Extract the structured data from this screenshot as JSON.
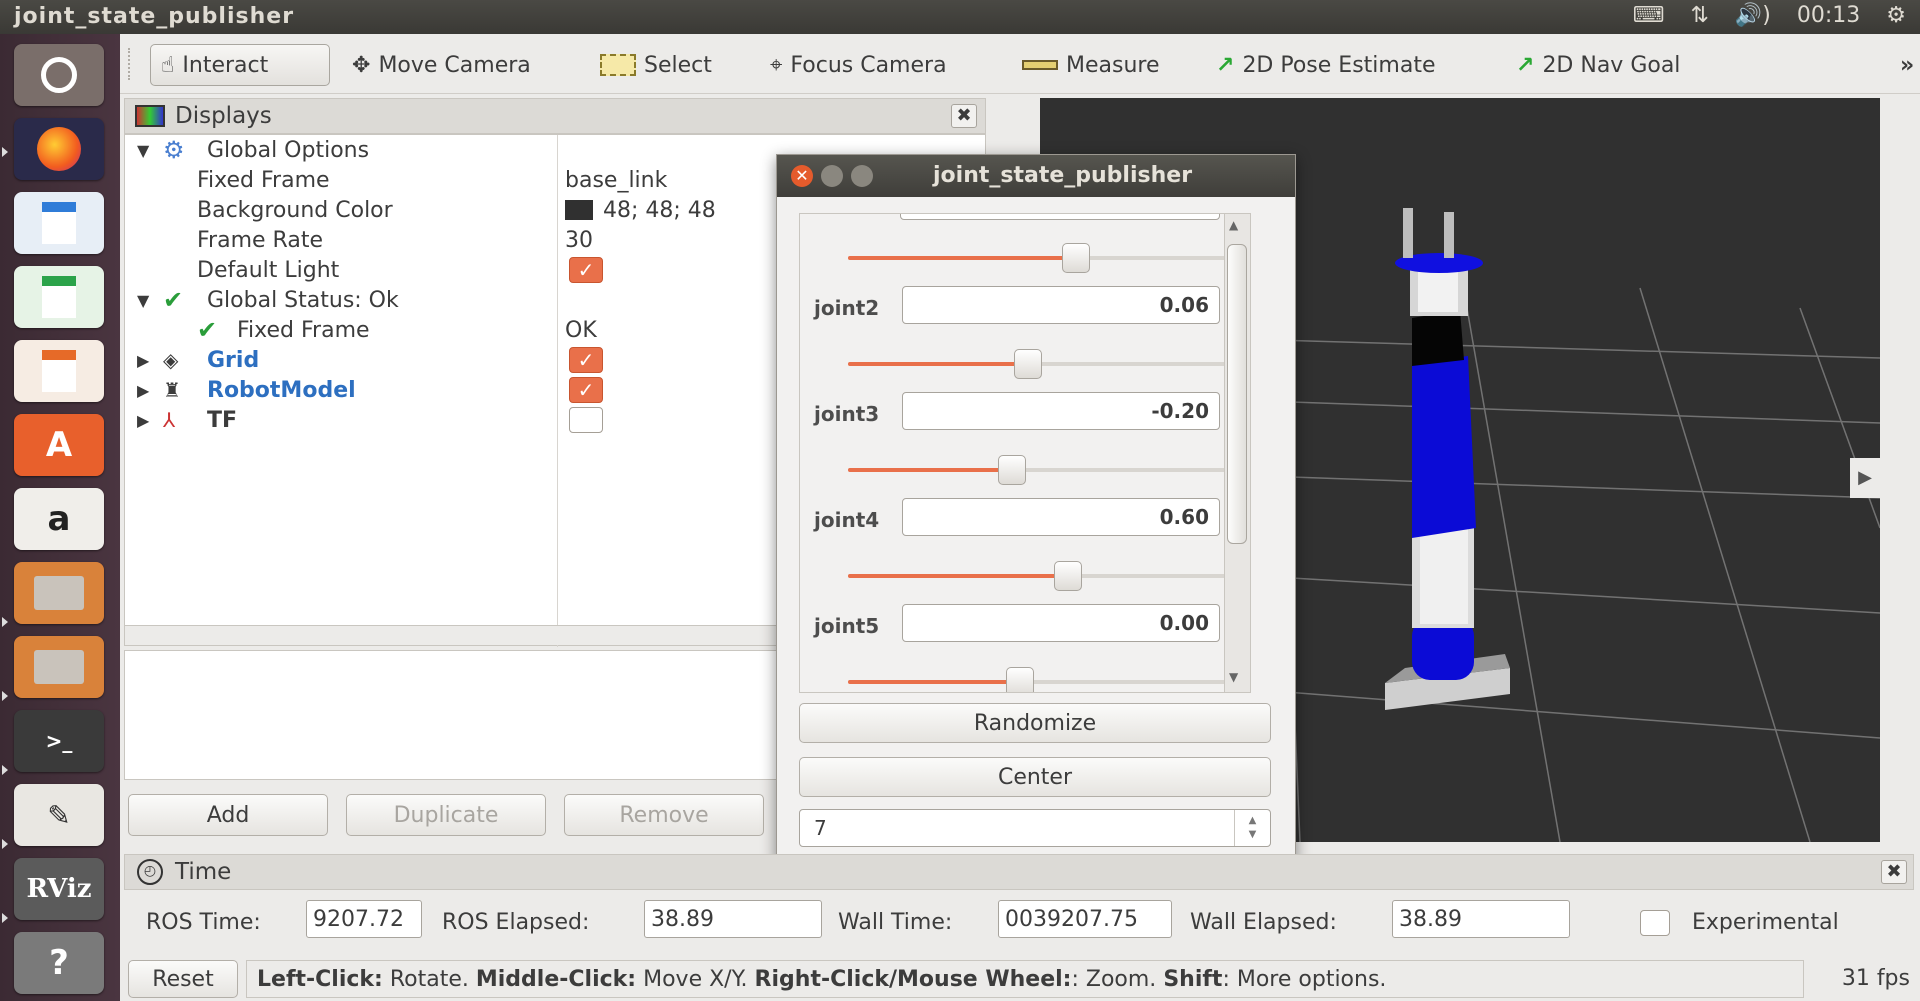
{
  "window": {
    "title": "joint_state_publisher"
  },
  "tray": {
    "arrows": "⇅",
    "volume": "🔊)",
    "clock": "00:13",
    "settings": "⚙"
  },
  "toolbar": {
    "interact": "Interact",
    "move_camera": "Move Camera",
    "select": "Select",
    "focus_camera": "Focus Camera",
    "measure": "Measure",
    "pose_estimate": "2D Pose Estimate",
    "nav_goal": "2D Nav Goal",
    "overflow": "»"
  },
  "displays": {
    "title": "Displays",
    "global_options": "Global Options",
    "fixed_frame_label": "Fixed Frame",
    "fixed_frame_value": "base_link",
    "bg_color_label": "Background Color",
    "bg_color_value": "48; 48; 48",
    "frame_rate_label": "Frame Rate",
    "frame_rate_value": "30",
    "default_light_label": "Default Light",
    "global_status": "Global Status: Ok",
    "status_fixed_frame": "Fixed Frame",
    "status_fixed_frame_value": "OK",
    "grid": "Grid",
    "robot_model": "RobotModel",
    "tf": "TF",
    "add": "Add",
    "duplicate": "Duplicate",
    "remove": "Remove"
  },
  "dialog": {
    "title": "joint_state_publisher",
    "joints": [
      {
        "name": "joint2",
        "value": "0.06",
        "fraction": 0.45
      },
      {
        "name": "joint3",
        "value": "-0.20",
        "fraction": 0.41
      },
      {
        "name": "joint4",
        "value": "0.60",
        "fraction": 0.55
      },
      {
        "name": "joint5",
        "value": "0.00",
        "fraction": 0.43
      }
    ],
    "top_slider_fraction": 0.57,
    "randomize": "Randomize",
    "center": "Center",
    "spin_value": "7"
  },
  "time": {
    "title": "Time",
    "ros_time_label": "ROS Time:",
    "ros_time_value": "9207.72",
    "ros_elapsed_label": "ROS Elapsed:",
    "ros_elapsed_value": "38.89",
    "wall_time_label": "Wall Time:",
    "wall_time_value": "0039207.75",
    "wall_elapsed_label": "Wall Elapsed:",
    "wall_elapsed_value": "38.89",
    "experimental": "Experimental"
  },
  "status": {
    "reset": "Reset",
    "h1": "Left-Click:",
    "t1": " Rotate. ",
    "h2": "Middle-Click:",
    "t2": " Move X/Y. ",
    "h3": "Right-Click/Mouse Wheel:",
    "t3": ": Zoom. ",
    "h4": "Shift",
    "t4": ": More options.",
    "fps": "31 fps"
  },
  "launcher": {
    "amazon": "a",
    "rviz": "RViz",
    "help": "?"
  },
  "colors": {
    "accent": "#e9704a",
    "link": "#2d6fc0",
    "viewport": "#303030",
    "robot_blue": "#0b0bd6"
  }
}
